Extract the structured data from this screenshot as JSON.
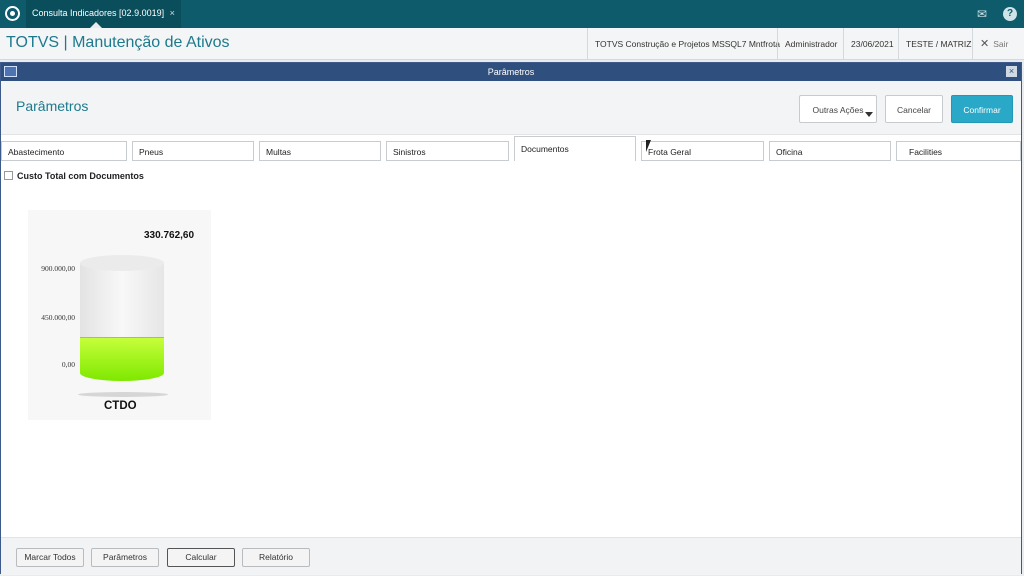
{
  "topbar": {
    "tab_label": "Consulta Indicadores [02.9.0019]",
    "tab_close": "×",
    "icons": [
      "totvs-logo-icon",
      "mail-icon",
      "help-icon"
    ],
    "help_glyph": "?"
  },
  "header": {
    "title": "TOTVS | Manutenção de Ativos",
    "company": "TOTVS Construção e Projetos MSSQL7 Mntfrota",
    "user": "Administrador",
    "date": "23/06/2021",
    "branch": "TESTE / MATRIZ",
    "exit_label": "Sair",
    "exit_glyph": "✕"
  },
  "dialog": {
    "window_title": "Parâmetros",
    "close_glyph": "×",
    "heading": "Parâmetros",
    "actions": {
      "outras": "Outras Ações",
      "cancelar": "Cancelar",
      "confirmar": "Confirmar"
    },
    "tabs": [
      "Abastecimento",
      "Pneus",
      "Multas",
      "Sinistros",
      "Documentos",
      "Frota Geral",
      "Oficina",
      "Facilities"
    ],
    "active_tab": "Documentos",
    "checkbox_label": "Custo Total com Documentos"
  },
  "gauge": {
    "value_label": "330.762,60",
    "value": 330762.6,
    "max": 900000,
    "ticks": [
      "900.000,00",
      "450.000,00",
      "0,00"
    ],
    "label": "CTDO",
    "fill_color": "#9cf000"
  },
  "footer": {
    "buttons": [
      "Marcar Todos",
      "Parâmetros",
      "Calcular",
      "Relatório"
    ]
  },
  "colors": {
    "topbar": "#0d5b6b",
    "accent": "#1d7a8c",
    "confirm": "#2aa8c8",
    "dialog_title": "#2f4f7f"
  }
}
